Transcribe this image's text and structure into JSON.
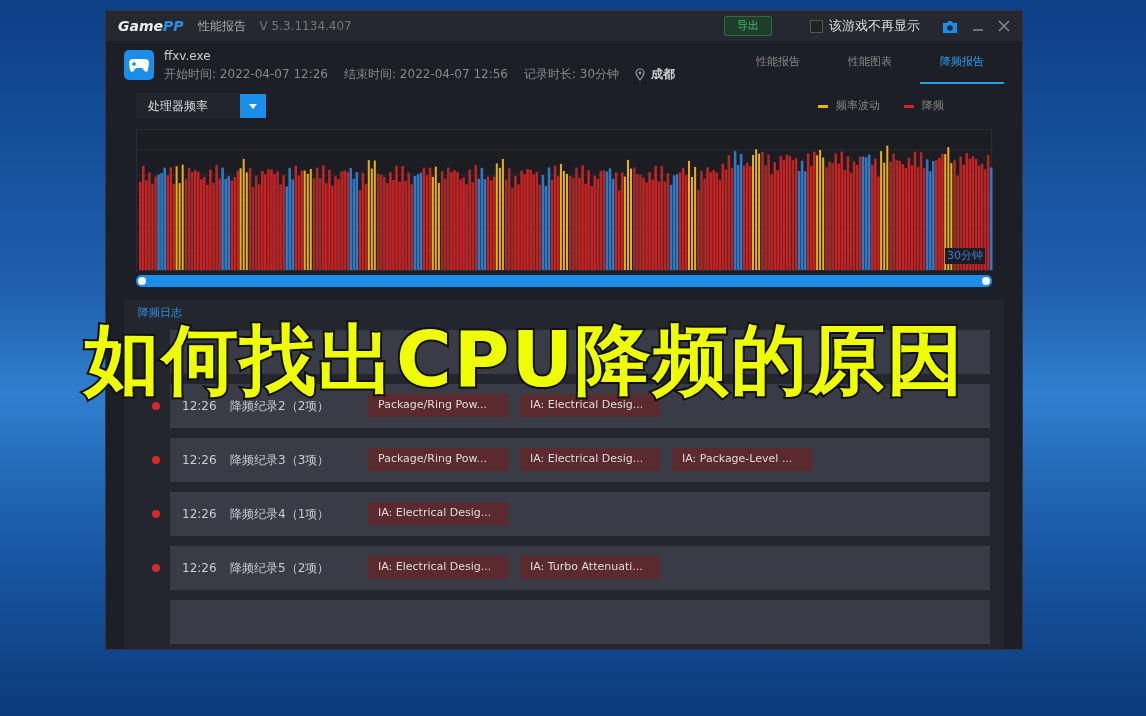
{
  "window": {
    "logo": [
      "Game",
      "PP"
    ],
    "title": "性能报告",
    "version": "V 5.3.1134.407"
  },
  "toolbar": {
    "export_button": "导出",
    "hide_checkbox": {
      "label": "该游戏不再显示",
      "checked": false
    }
  },
  "session": {
    "exe": "ffxv.exe",
    "start": "开始时间: 2022-04-07 12:26",
    "end": "结束时间: 2022-04-07 12:56",
    "duration": "记录时长: 30分钟",
    "location": "成都"
  },
  "tabs": [
    {
      "label": "性能报告",
      "selected": false
    },
    {
      "label": "性能图表",
      "selected": false
    },
    {
      "label": "降频报告",
      "selected": true
    }
  ],
  "metric_select": {
    "value": "处理器频率"
  },
  "legend": [
    {
      "label": "频率波动",
      "color": "#f0b400"
    },
    {
      "label": "降频",
      "color": "#d02525"
    }
  ],
  "chart": {
    "end_label": "30分钟"
  },
  "range_slider": {
    "level": 1
  },
  "log": {
    "title": "降频日志",
    "rows": [
      {
        "time": "12:26",
        "name": "降频纪录2（2项）",
        "tags": [
          "Package/Ring Pow...",
          "IA: Electrical Desig..."
        ]
      },
      {
        "time": "12:26",
        "name": "降频纪录3（3项）",
        "tags": [
          "Package/Ring Pow...",
          "IA: Electrical Desig...",
          "IA: Package-Level ..."
        ]
      },
      {
        "time": "12:26",
        "name": "降频纪录4（1项）",
        "tags": [
          "IA: Electrical Desig..."
        ]
      },
      {
        "time": "12:26",
        "name": "降频纪录5（2项）",
        "tags": [
          "IA: Electrical Desig...",
          "IA: Turbo Attenuati..."
        ]
      }
    ]
  },
  "overlay_title": "如何找出CPU降频的原因"
}
